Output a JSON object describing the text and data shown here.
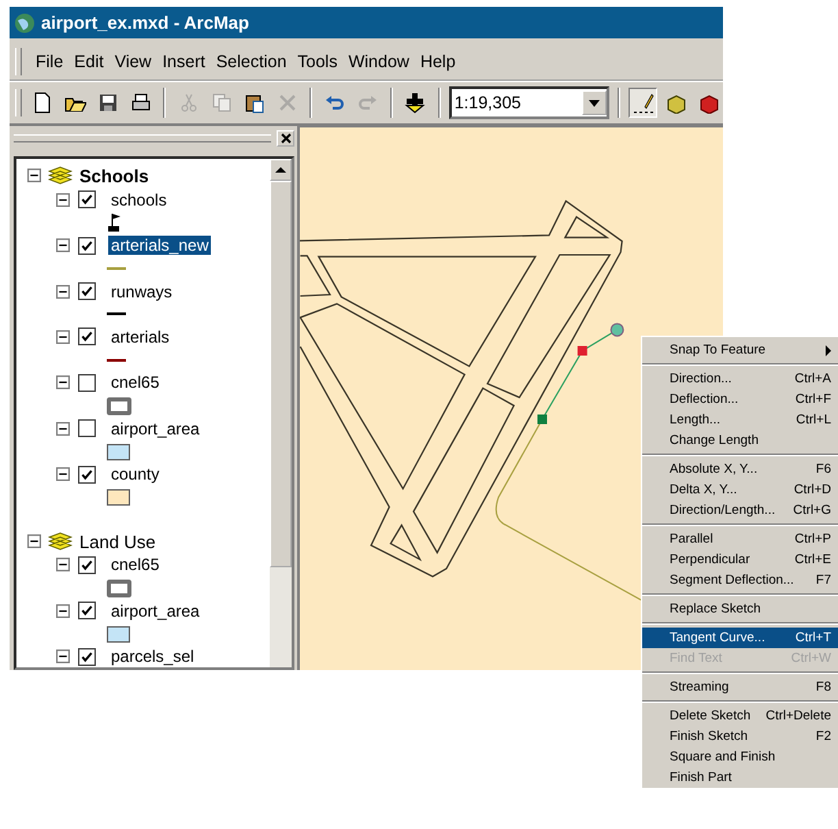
{
  "window": {
    "title": "airport_ex.mxd - ArcMap"
  },
  "menu_bar": [
    "File",
    "Edit",
    "View",
    "Insert",
    "Selection",
    "Tools",
    "Window",
    "Help"
  ],
  "toolbar": {
    "scale": "1:19,305",
    "editor_tool": {
      "selected": true
    },
    "items": [
      {
        "kind": "new",
        "disabled": false
      },
      {
        "kind": "open",
        "disabled": false
      },
      {
        "kind": "save",
        "disabled": false
      },
      {
        "kind": "print",
        "disabled": false
      },
      {
        "kind": "sep"
      },
      {
        "kind": "cut",
        "disabled": true
      },
      {
        "kind": "copy",
        "disabled": true
      },
      {
        "kind": "paste",
        "disabled": false
      },
      {
        "kind": "delete",
        "disabled": true
      },
      {
        "kind": "sep"
      },
      {
        "kind": "undo",
        "disabled": false
      },
      {
        "kind": "redo",
        "disabled": true
      },
      {
        "kind": "sep"
      },
      {
        "kind": "add-data",
        "disabled": false
      }
    ]
  },
  "toc": {
    "groups": [
      {
        "name": "Schools",
        "active": true,
        "expanded": true,
        "layers": [
          {
            "name": "schools",
            "checked": true,
            "selected": false,
            "symbol": {
              "kind": "marker",
              "color": "#000000"
            }
          },
          {
            "name": "arterials_new",
            "checked": true,
            "selected": true,
            "symbol": {
              "kind": "line",
              "color": "#a8a040"
            }
          },
          {
            "name": "runways",
            "checked": true,
            "selected": false,
            "symbol": {
              "kind": "line",
              "color": "#000000"
            }
          },
          {
            "name": "arterials",
            "checked": true,
            "selected": false,
            "symbol": {
              "kind": "line",
              "color": "#8b0000"
            }
          },
          {
            "name": "cnel65",
            "checked": false,
            "selected": false,
            "symbol": {
              "kind": "outline",
              "color": "#707070"
            }
          },
          {
            "name": "airport_area",
            "checked": false,
            "selected": false,
            "symbol": {
              "kind": "fill",
              "color": "#c4e4f6"
            }
          },
          {
            "name": "county",
            "checked": true,
            "selected": false,
            "symbol": {
              "kind": "fill",
              "color": "#fde7bd"
            }
          }
        ]
      },
      {
        "name": "Land Use",
        "active": false,
        "expanded": true,
        "layers": [
          {
            "name": "cnel65",
            "checked": true,
            "selected": false,
            "symbol": {
              "kind": "outline",
              "color": "#707070"
            }
          },
          {
            "name": "airport_area",
            "checked": true,
            "selected": false,
            "symbol": {
              "kind": "fill",
              "color": "#c4e4f6"
            }
          },
          {
            "name": "parcels_sel",
            "checked": true,
            "selected": false
          }
        ]
      }
    ]
  },
  "context_menu": {
    "sections": [
      [
        {
          "label": "Snap To Feature",
          "submenu": true,
          "selected": false,
          "disabled": false
        }
      ],
      [
        {
          "label": "Direction...",
          "shortcut": "Ctrl+A",
          "selected": false,
          "disabled": false
        },
        {
          "label": "Deflection...",
          "shortcut": "Ctrl+F",
          "selected": false,
          "disabled": false
        },
        {
          "label": "Length...",
          "shortcut": "Ctrl+L",
          "selected": false,
          "disabled": false
        },
        {
          "label": "Change Length",
          "selected": false,
          "disabled": false
        }
      ],
      [
        {
          "label": "Absolute X, Y...",
          "shortcut": "F6",
          "selected": false,
          "disabled": false
        },
        {
          "label": "Delta X, Y...",
          "shortcut": "Ctrl+D",
          "selected": false,
          "disabled": false
        },
        {
          "label": "Direction/Length...",
          "shortcut": "Ctrl+G",
          "selected": false,
          "disabled": false
        }
      ],
      [
        {
          "label": "Parallel",
          "shortcut": "Ctrl+P",
          "selected": false,
          "disabled": false
        },
        {
          "label": "Perpendicular",
          "shortcut": "Ctrl+E",
          "selected": false,
          "disabled": false
        },
        {
          "label": "Segment Deflection...",
          "shortcut": "F7",
          "selected": false,
          "disabled": false
        }
      ],
      [
        {
          "label": "Replace Sketch",
          "selected": false,
          "disabled": false
        }
      ],
      [
        {
          "label": "Tangent Curve...",
          "shortcut": "Ctrl+T",
          "selected": true,
          "disabled": false
        },
        {
          "label": "Find Text",
          "shortcut": "Ctrl+W",
          "selected": false,
          "disabled": true
        }
      ],
      [
        {
          "label": "Streaming",
          "shortcut": "F8",
          "selected": false,
          "disabled": false
        }
      ],
      [
        {
          "label": "Delete Sketch",
          "shortcut": "Ctrl+Delete",
          "selected": false,
          "disabled": false
        },
        {
          "label": "Finish Sketch",
          "shortcut": "F2",
          "selected": false,
          "disabled": false
        },
        {
          "label": "Square and Finish",
          "selected": false,
          "disabled": false
        },
        {
          "label": "Finish Part",
          "selected": false,
          "disabled": false
        }
      ]
    ]
  }
}
